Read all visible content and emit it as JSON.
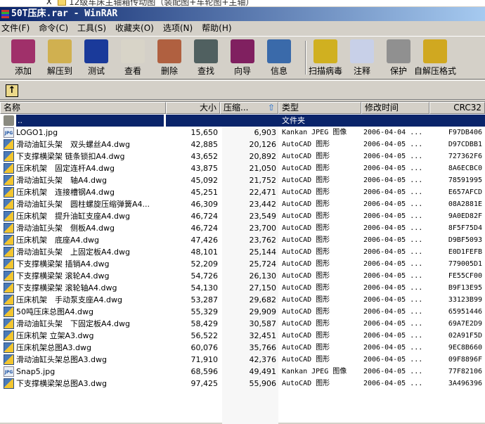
{
  "taskbar": {
    "close": "X",
    "title": "12级车床主轴箱传动图（装配图+车轮图+主轴）"
  },
  "window": {
    "title": "50T压床.rar - WinRAR"
  },
  "menu": [
    "文件(F)",
    "命令(C)",
    "工具(S)",
    "收藏夹(O)",
    "选项(N)",
    "帮助(H)"
  ],
  "toolbar": [
    {
      "label": "添加",
      "icon": "add-archive-icon",
      "color": "#a0306a"
    },
    {
      "label": "解压到",
      "icon": "extract-icon",
      "color": "#d0b050"
    },
    {
      "label": "测试",
      "icon": "test-icon",
      "color": "#1a3a9a"
    },
    {
      "label": "查看",
      "icon": "view-icon",
      "color": "#d8d4c8"
    },
    {
      "label": "删除",
      "icon": "delete-icon",
      "color": "#b06040"
    },
    {
      "label": "查找",
      "icon": "find-icon",
      "color": "#506060"
    },
    {
      "label": "向导",
      "icon": "wizard-icon",
      "color": "#802060"
    },
    {
      "label": "信息",
      "icon": "info-icon",
      "color": "#3a6aaa"
    },
    {
      "label": "扫描病毒",
      "icon": "virus-scan-icon",
      "color": "#d0b020"
    },
    {
      "label": "注释",
      "icon": "comment-icon",
      "color": "#c8d0e8"
    },
    {
      "label": "保护",
      "icon": "protect-icon",
      "color": "#909090"
    },
    {
      "label": "自解压格式",
      "icon": "sfx-icon",
      "color": "#d0a820"
    }
  ],
  "columns": [
    "名称",
    "大小",
    "压缩...",
    "类型",
    "修改时间",
    "CRC32"
  ],
  "sort_indicator": "⇧",
  "parent_row": {
    "name": "..",
    "type": "文件夹"
  },
  "files": [
    {
      "name": "LOGO1.jpg",
      "size": "15,650",
      "packed": "6,903",
      "type": "Kankan JPEG 图像",
      "modified": "2006-04-04 ...",
      "crc": "F97DB406",
      "icon": "jpg"
    },
    {
      "name": "滑动油缸头架　双头螺丝A4.dwg",
      "size": "42,885",
      "packed": "20,126",
      "type": "AutoCAD 图形",
      "modified": "2006-04-05 ...",
      "crc": "D97CDBB1",
      "icon": "dwg"
    },
    {
      "name": "下支撑横梁架 链条锁扣A4.dwg",
      "size": "43,652",
      "packed": "20,892",
      "type": "AutoCAD 图形",
      "modified": "2006-04-05 ...",
      "crc": "727362F6",
      "icon": "dwg"
    },
    {
      "name": "压床机架　固定连杆A4.dwg",
      "size": "43,875",
      "packed": "21,050",
      "type": "AutoCAD 图形",
      "modified": "2006-04-05 ...",
      "crc": "8A6ECBC0",
      "icon": "dwg"
    },
    {
      "name": "滑动油缸头架　轴A4.dwg",
      "size": "45,092",
      "packed": "21,752",
      "type": "AutoCAD 图形",
      "modified": "2006-04-05 ...",
      "crc": "78591995",
      "icon": "dwg"
    },
    {
      "name": "压床机架　连接槽钢A4.dwg",
      "size": "45,251",
      "packed": "22,471",
      "type": "AutoCAD 图形",
      "modified": "2006-04-05 ...",
      "crc": "E657AFCD",
      "icon": "dwg"
    },
    {
      "name": "滑动油缸头架　圆柱螺旋压缩弹簧A4...",
      "size": "46,309",
      "packed": "23,442",
      "type": "AutoCAD 图形",
      "modified": "2006-04-05 ...",
      "crc": "08A2881E",
      "icon": "dwg"
    },
    {
      "name": "压床机架　提升油缸支座A4.dwg",
      "size": "46,724",
      "packed": "23,549",
      "type": "AutoCAD 图形",
      "modified": "2006-04-05 ...",
      "crc": "9A0ED82F",
      "icon": "dwg"
    },
    {
      "name": "滑动油缸头架　侧板A4.dwg",
      "size": "46,724",
      "packed": "23,700",
      "type": "AutoCAD 图形",
      "modified": "2006-04-05 ...",
      "crc": "8F5F75D4",
      "icon": "dwg"
    },
    {
      "name": "压床机架　底座A4.dwg",
      "size": "47,426",
      "packed": "23,762",
      "type": "AutoCAD 图形",
      "modified": "2006-04-05 ...",
      "crc": "D9BF5093",
      "icon": "dwg"
    },
    {
      "name": "滑动油缸头架　上固定板A4.dwg",
      "size": "48,101",
      "packed": "25,144",
      "type": "AutoCAD 图形",
      "modified": "2006-04-05 ...",
      "crc": "E0D1FEFB",
      "icon": "dwg"
    },
    {
      "name": "下支撑横梁架 插销A4.dwg",
      "size": "52,209",
      "packed": "25,724",
      "type": "AutoCAD 图形",
      "modified": "2006-04-05 ...",
      "crc": "779005D1",
      "icon": "dwg"
    },
    {
      "name": "下支撑横梁架 滚轮A4.dwg",
      "size": "54,726",
      "packed": "26,130",
      "type": "AutoCAD 图形",
      "modified": "2006-04-05 ...",
      "crc": "FE55CF00",
      "icon": "dwg"
    },
    {
      "name": "下支撑横梁架 滚轮轴A4.dwg",
      "size": "54,130",
      "packed": "27,150",
      "type": "AutoCAD 图形",
      "modified": "2006-04-05 ...",
      "crc": "B9F13E95",
      "icon": "dwg"
    },
    {
      "name": "压床机架　手动泵支座A4.dwg",
      "size": "53,287",
      "packed": "29,682",
      "type": "AutoCAD 图形",
      "modified": "2006-04-05 ...",
      "crc": "33123B99",
      "icon": "dwg"
    },
    {
      "name": "50吨压床总图A4.dwg",
      "size": "55,329",
      "packed": "29,909",
      "type": "AutoCAD 图形",
      "modified": "2006-04-05 ...",
      "crc": "65951446",
      "icon": "dwg"
    },
    {
      "name": "滑动油缸头架　下固定板A4.dwg",
      "size": "58,429",
      "packed": "30,587",
      "type": "AutoCAD 图形",
      "modified": "2006-04-05 ...",
      "crc": "69A7E2D9",
      "icon": "dwg"
    },
    {
      "name": "压床机架 立架A3.dwg",
      "size": "56,522",
      "packed": "32,451",
      "type": "AutoCAD 图形",
      "modified": "2006-04-05 ...",
      "crc": "02A91F5D",
      "icon": "dwg"
    },
    {
      "name": "压床机架总图A3.dwg",
      "size": "60,076",
      "packed": "35,766",
      "type": "AutoCAD 图形",
      "modified": "2006-04-05 ...",
      "crc": "9EC8B660",
      "icon": "dwg"
    },
    {
      "name": "滑动油缸头架总图A3.dwg",
      "size": "71,910",
      "packed": "42,376",
      "type": "AutoCAD 图形",
      "modified": "2006-04-05 ...",
      "crc": "09F8896F",
      "icon": "dwg"
    },
    {
      "name": "Snap5.jpg",
      "size": "68,596",
      "packed": "49,491",
      "type": "Kankan JPEG 图像",
      "modified": "2006-04-05 ...",
      "crc": "77F82106",
      "icon": "jpg"
    },
    {
      "name": "下支撑横梁架总图A3.dwg",
      "size": "97,425",
      "packed": "55,906",
      "type": "AutoCAD 图形",
      "modified": "2006-04-05 ...",
      "crc": "3A496396",
      "icon": "dwg"
    }
  ]
}
